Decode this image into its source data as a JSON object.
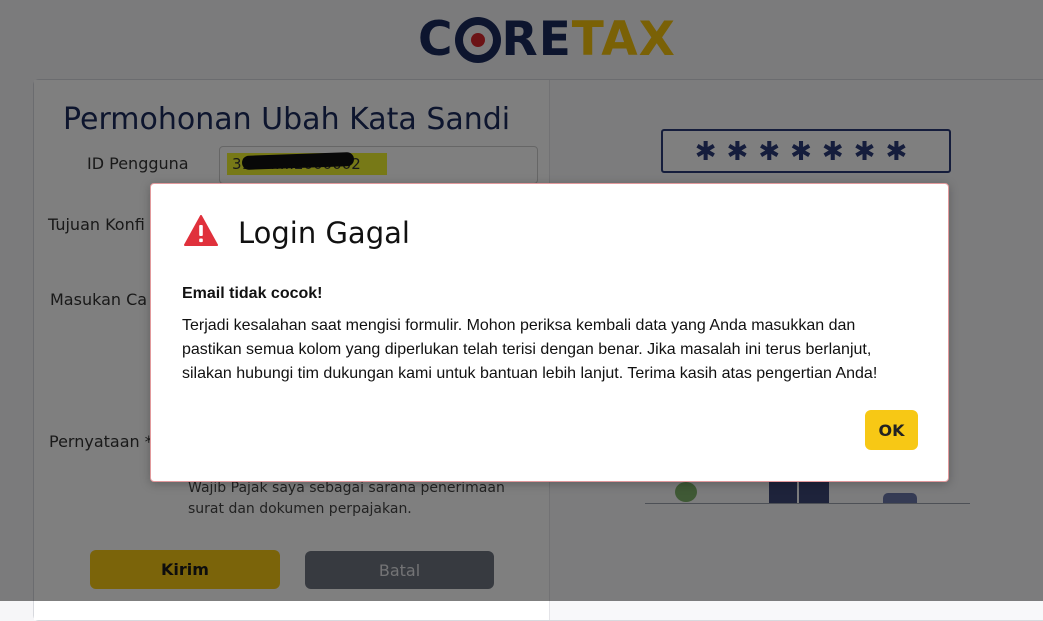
{
  "logo": {
    "part1": "C",
    "part2": "RE",
    "part3": "TAX"
  },
  "form": {
    "title": "Permohonan Ubah Kata Sandi",
    "user_id_label": "ID Pengguna",
    "user_id_value": "3171.....2000002",
    "confirm_target_label": "Tujuan Konfi",
    "captcha_input_label": "Masukan Ca",
    "statement_label": "Pernyataan *",
    "statement_text": "Wajib Pajak saya sebagai sarana penerimaan surat dan dokumen perpajakan.",
    "submit_label": "Kirim",
    "cancel_label": "Batal"
  },
  "captcha": {
    "text": "✱✱✱✱✱✱✱"
  },
  "dialog": {
    "title": "Login Gagal",
    "icon": "warning-icon",
    "subtitle": "Email tidak cocok!",
    "message": "Terjadi kesalahan saat mengisi formulir. Mohon periksa kembali data yang Anda masukkan dan pastikan semua kolom yang diperlukan telah terisi dengan benar. Jika masalah ini terus berlanjut, silakan hubungi tim dukungan kami untuk bantuan lebih lanjut. Terima kasih atas pengertian Anda!",
    "ok_label": "OK"
  },
  "colors": {
    "brand_navy": "#1b2a5c",
    "brand_yellow": "#f7c815",
    "error_red": "#e0313c"
  }
}
